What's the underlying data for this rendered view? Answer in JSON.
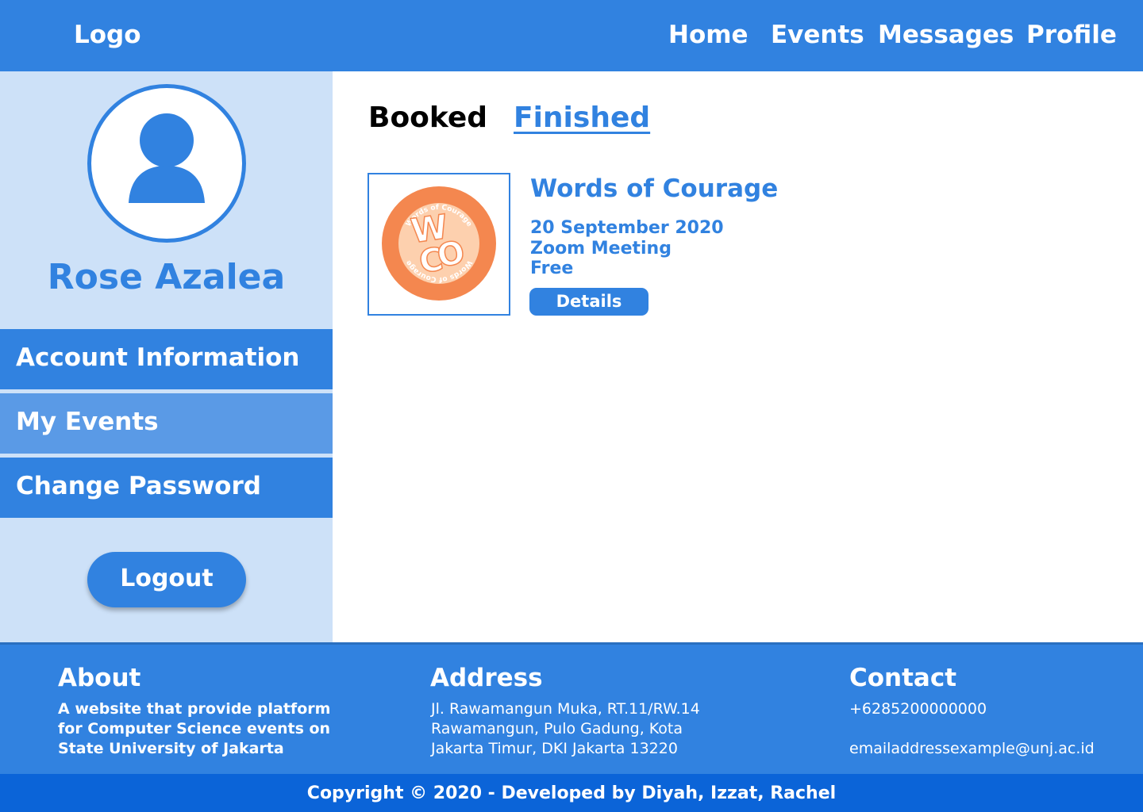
{
  "header": {
    "logo": "Logo",
    "nav": [
      "Home",
      "Events",
      "Messages",
      "Profile"
    ]
  },
  "sidebar": {
    "profile_name": "Rose Azalea",
    "menu": [
      "Account Information",
      "My Events",
      "Change Password"
    ],
    "active_menu": "My Events",
    "logout_label": "Logout"
  },
  "tabs": {
    "booked": "Booked",
    "finished": "Finished"
  },
  "event": {
    "title": "Words of Courage",
    "date": "20 September 2020",
    "location": "Zoom Meeting",
    "price": "Free",
    "details_label": "Details",
    "logo_text": "Words of Courage",
    "logo_letters": [
      "W",
      "C",
      "O"
    ]
  },
  "footer": {
    "about_heading": "About",
    "about_lines": [
      "A website that provide platform",
      "for Computer Science events on",
      "State University of Jakarta"
    ],
    "address_heading": "Address",
    "address_lines": [
      "Jl. Rawamangun Muka, RT.11/RW.14",
      "Rawamangun, Pulo Gadung, Kota",
      "Jakarta Timur, DKI Jakarta 13220"
    ],
    "contact_heading": "Contact",
    "phone": "+6285200000000",
    "email": "emailaddressexample@unj.ac.id",
    "copyright": "Copyright © 2020 - Developed by Diyah, Izzat, Rachel"
  },
  "colors": {
    "primary": "#3182e0",
    "sidebar_bg": "#cde1f8",
    "active_menu": "#5a9ae6",
    "copyright_bg": "#0b64d8",
    "logo_orange": "#f4874f",
    "logo_peach": "#fdd0ae"
  },
  "icons": {
    "avatar": "user-silhouette-icon"
  }
}
